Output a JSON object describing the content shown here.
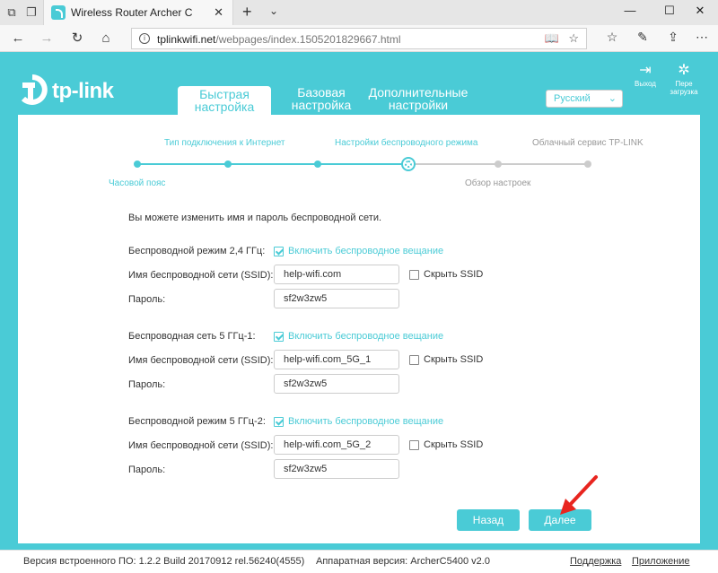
{
  "browser": {
    "tab_title": "Wireless Router Archer C",
    "url_host": "tplinkwifi.net",
    "url_path": "/webpages/index.1505201829667.html"
  },
  "header": {
    "logo": "tp-link",
    "tabs": [
      {
        "line1": "Быстрая",
        "line2": "настройка",
        "active": true
      },
      {
        "line1": "Базовая",
        "line2": "настройка",
        "active": false
      },
      {
        "line1": "Дополнительные",
        "line2": "настройки",
        "active": false
      }
    ],
    "language": "Русский",
    "logout_label": "Выход",
    "reboot_label_1": "Пере",
    "reboot_label_2": "загрузка"
  },
  "progress": {
    "top_labels": [
      "Тип подключения к Интернет",
      "Настройки беспроводного режима",
      "Облачный сервис TP-LINK"
    ],
    "bottom_labels": [
      "Часовой пояс",
      "Обзор настроек"
    ],
    "current_step": 4,
    "total_steps": 6
  },
  "form": {
    "intro": "Вы можете изменить имя и пароль беспроводной сети.",
    "sections": [
      {
        "band_label": "Беспроводной режим 2,4 ГГц:",
        "enable_label": "Включить беспроводное вещание",
        "enabled": true,
        "ssid_label": "Имя беспроводной сети (SSID):",
        "ssid": "help-wifi.com",
        "hide_label": "Скрыть SSID",
        "hidden": false,
        "password_label": "Пароль:",
        "password": "sf2w3zw5"
      },
      {
        "band_label": "Беспроводная сеть 5 ГГц-1:",
        "enable_label": "Включить беспроводное вещание",
        "enabled": true,
        "ssid_label": "Имя беспроводной сети (SSID):",
        "ssid": "help-wifi.com_5G_1",
        "hide_label": "Скрыть SSID",
        "hidden": false,
        "password_label": "Пароль:",
        "password": "sf2w3zw5"
      },
      {
        "band_label": "Беспроводной режим 5 ГГц-2:",
        "enable_label": "Включить беспроводное вещание",
        "enabled": true,
        "ssid_label": "Имя беспроводной сети (SSID):",
        "ssid": "help-wifi.com_5G_2",
        "hide_label": "Скрыть SSID",
        "hidden": false,
        "password_label": "Пароль:",
        "password": "sf2w3zw5"
      }
    ],
    "back_label": "Назад",
    "next_label": "Далее"
  },
  "footer": {
    "firmware": "Версия встроенного ПО: 1.2.2 Build 20170912 rel.56240(4555)",
    "hardware": "Аппаратная версия: ArcherC5400 v2.0",
    "support": "Поддержка",
    "app": "Приложение"
  },
  "colors": {
    "accent": "#4acbd6",
    "arrow": "#e8251f"
  }
}
